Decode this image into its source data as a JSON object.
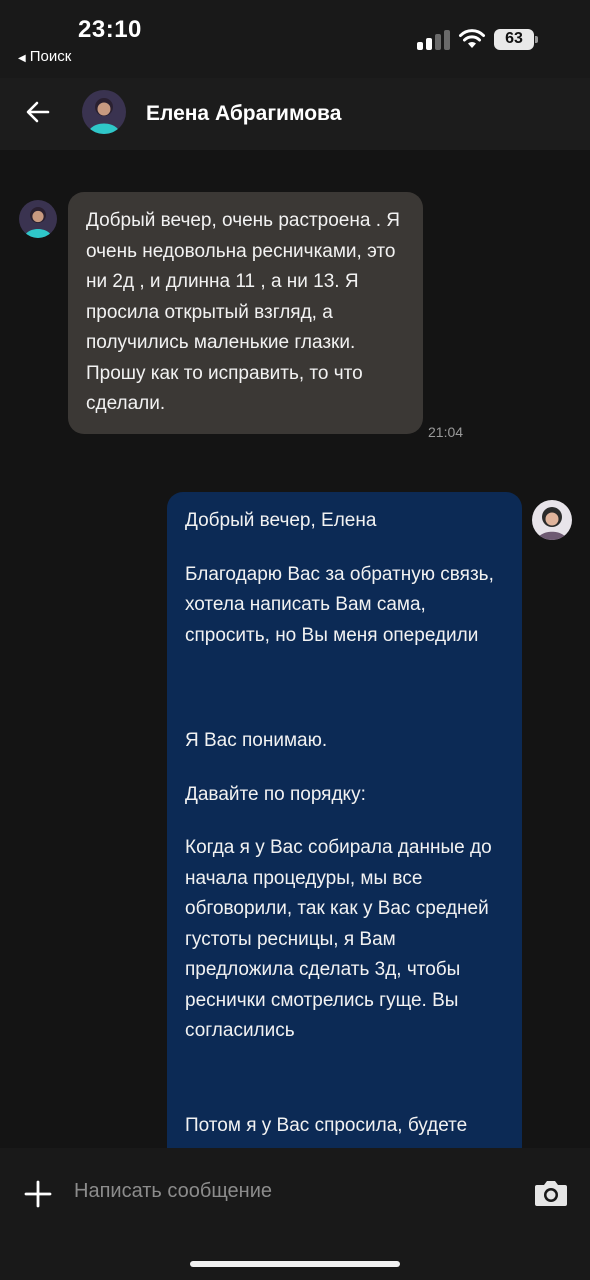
{
  "status_bar": {
    "time": "23:10",
    "back_label": "Поиск",
    "battery": "63",
    "signal_icon": "cellular-signal-icon",
    "wifi_icon": "wifi-icon"
  },
  "header": {
    "contact_name": "Елена Абрагимова",
    "back_icon": "arrow-left-icon"
  },
  "messages": [
    {
      "direction": "incoming",
      "text": "Добрый вечер, очень растроена .  Я очень недовольна ресничками, это ни 2д  , и длинна  11 , а ни 13. Я просила открытый взгляд, а получились маленькие глазки. Прошу как то исправить, то что сделали.",
      "time": "21:04"
    },
    {
      "direction": "outgoing",
      "paragraphs": [
        "Добрый вечер, Елена",
        "Благодарю Вас за обратную связь, хотела написать Вам сама, спросить, но Вы меня опередили",
        "Я Вас понимаю.",
        "Давайте по порядку:",
        "Когда я у Вас собирала данные до начала процедуры, мы все обговорили, так как у Вас средней густоты ресницы, я Вам предложила сделать 3д, чтобы реснички смотрелись гуще. Вы согласились",
        "Потом я у Вас спросила, будете"
      ]
    }
  ],
  "composer": {
    "placeholder": "Написать сообщение",
    "add_icon": "plus-icon",
    "camera_icon": "camera-icon"
  },
  "colors": {
    "background": "#141414",
    "header": "#1c1c1c",
    "incoming_bubble": "#3b3835",
    "outgoing_bubble": "#0c2a55"
  }
}
